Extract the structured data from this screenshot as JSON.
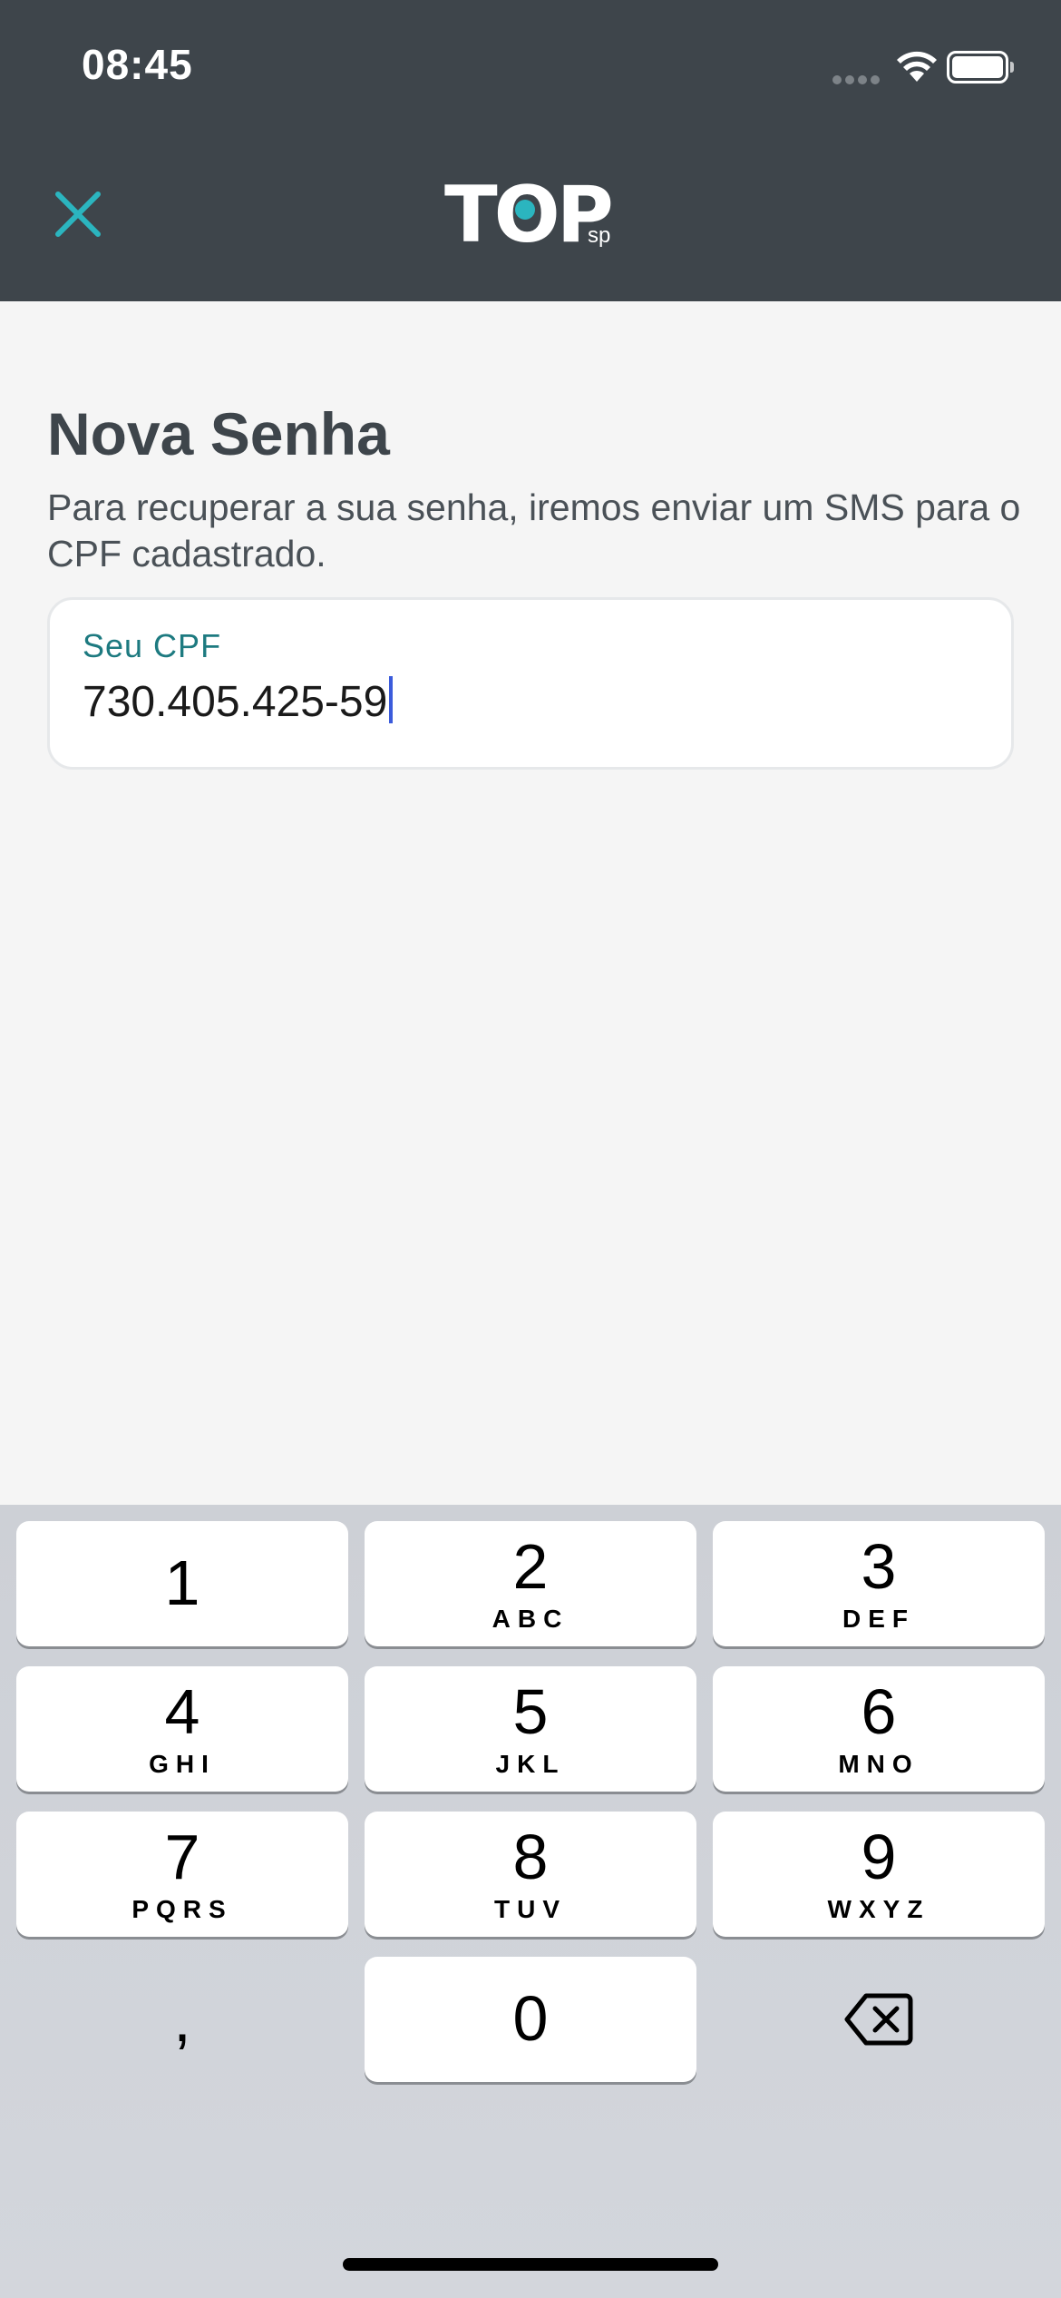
{
  "status_bar": {
    "time": "08:45"
  },
  "header": {
    "close_icon": "close-icon",
    "logo_main": "TOP",
    "logo_sub": "sp",
    "accent_color": "#2bb5bf",
    "background_color": "#3e454b"
  },
  "form": {
    "title": "Nova Senha",
    "description": "Para recuperar a sua senha, iremos enviar um SMS para o CPF cadastrado.",
    "cpf_label": "Seu CPF",
    "cpf_value": "730.405.425-59"
  },
  "keyboard": {
    "keys": [
      {
        "digit": "1",
        "letters": ""
      },
      {
        "digit": "2",
        "letters": "ABC"
      },
      {
        "digit": "3",
        "letters": "DEF"
      },
      {
        "digit": "4",
        "letters": "GHI"
      },
      {
        "digit": "5",
        "letters": "JKL"
      },
      {
        "digit": "6",
        "letters": "MNO"
      },
      {
        "digit": "7",
        "letters": "PQRS"
      },
      {
        "digit": "8",
        "letters": "TUV"
      },
      {
        "digit": "9",
        "letters": "WXYZ"
      },
      {
        "digit": "0",
        "letters": ""
      }
    ],
    "comma": ",",
    "delete_icon": "backspace-icon"
  }
}
